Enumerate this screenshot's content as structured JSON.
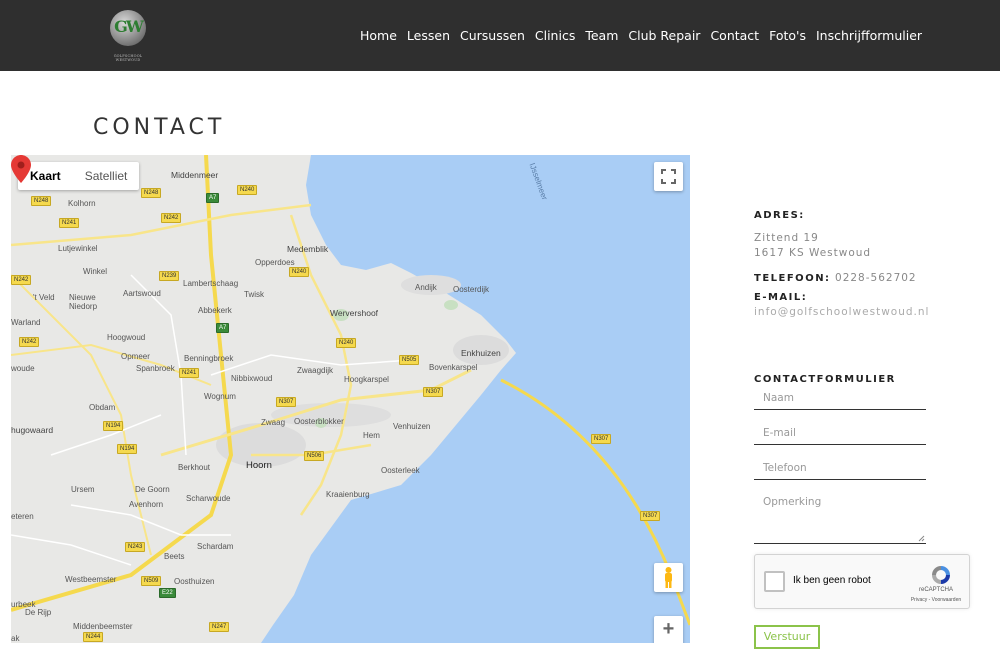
{
  "brand": {
    "logo_letters": "GW",
    "logo_text": "GOLFSCHOOL WESTWOUD"
  },
  "nav": {
    "items": [
      {
        "label": "Home"
      },
      {
        "label": "Lessen"
      },
      {
        "label": "Cursussen"
      },
      {
        "label": "Clinics"
      },
      {
        "label": "Team"
      },
      {
        "label": "Club Repair"
      },
      {
        "label": "Contact"
      },
      {
        "label": "Foto's"
      },
      {
        "label": "Inschrijfformulier"
      }
    ]
  },
  "page": {
    "title": "CONTACT"
  },
  "map": {
    "type_buttons": {
      "map": "Kaart",
      "satellite": "Satelliet"
    },
    "zoom_in": "+",
    "labels": {
      "ijsselmeer": "IJsselmeer",
      "middenmeer": "Middenmeer",
      "kolhorn": "Kolhorn",
      "lutjewinkel": "Lutjewinkel",
      "winkel": "Winkel",
      "lambertschaag": "Lambertschaag",
      "medemblik": "Medemblik",
      "opperdoes": "Opperdoes",
      "twisk": "Twisk",
      "abbekerk": "Abbekerk",
      "aartswoud": "Aartswoud",
      "tveld": "'t Veld",
      "nieuwe_niedorp": "Nieuwe\nNiedorp",
      "warland": "Warland",
      "hoogwoud": "Hoogwoud",
      "opmeer": "Opmeer",
      "spanbroek": "Spanbroek",
      "benningbroek": "Benningbroek",
      "wervershoof": "Wervershoof",
      "andijk": "Andijk",
      "oosterdijk": "Oosterdijk",
      "enkhuizen": "Enkhuizen",
      "bovenkarspel": "Bovenkarspel",
      "hoogkarspel": "Hoogkarspel",
      "zwaagdijk": "Zwaagdijk",
      "nibbixwoud": "Nibbixwoud",
      "wognum": "Wognum",
      "woude": "woude",
      "obdam": "Obdam",
      "hugowaard": "hugowaard",
      "zwaag": "Zwaag",
      "oosterblokker": "Oosterblokker",
      "hem": "Hem",
      "venhuizen": "Venhuizen",
      "berkhout": "Berkhout",
      "hoorn": "Hoorn",
      "oosterleek": "Oosterleek",
      "ursem": "Ursem",
      "de_goorn": "De Goorn",
      "avenhorn": "Avenhorn",
      "scharwoude": "Scharwoude",
      "kraaienburg": "Kraaienburg",
      "eteren": "eteren",
      "schardam": "Schardam",
      "beets": "Beets",
      "westbeemster": "Westbeemster",
      "oosthuizen": "Oosthuizen",
      "de_rijp": "De Rijp",
      "middenbeemster": "Middenbeemster",
      "urbeek": "urbeek",
      "ak": "ak"
    },
    "roads": {
      "n248a": "N248",
      "n240a": "N240",
      "a7a": "A7",
      "n248b": "N248",
      "n242a": "N242",
      "n241a": "N241",
      "n239": "N239",
      "n240b": "N240",
      "n242b": "N242",
      "a7b": "A7",
      "n240c": "N240",
      "n505": "N505",
      "n241b": "N241",
      "n307a": "N307",
      "n307b": "N307",
      "n194a": "N194",
      "n194b": "N194",
      "n506": "N506",
      "n307c": "N307",
      "n307d": "N307",
      "n243": "N243",
      "n509": "N509",
      "e22": "E22",
      "n247": "N247",
      "n244": "N244"
    }
  },
  "contact": {
    "address_heading": "ADRES:",
    "address_line1": "Zittend 19",
    "address_line2": "1617 KS Westwoud",
    "phone_heading": "TELEFOON:",
    "phone": "0228-562702",
    "email_heading": "E-MAIL:",
    "email": "info@golfschoolwestwoud.nl"
  },
  "form": {
    "heading": "CONTACTFORMULIER",
    "name_placeholder": "Naam",
    "email_placeholder": "E-mail",
    "phone_placeholder": "Telefoon",
    "remark_placeholder": "Opmerking",
    "submit_label": "Verstuur"
  },
  "recaptcha": {
    "label": "Ik ben geen robot",
    "brand": "reCAPTCHA",
    "terms": "Privacy - Voorwaarden"
  },
  "colors": {
    "header_bg": "#2f2f2f",
    "water": "#a9cdf5",
    "land": "#e8e8e6",
    "accent": "#8bc34a",
    "marker": "#e53935"
  }
}
